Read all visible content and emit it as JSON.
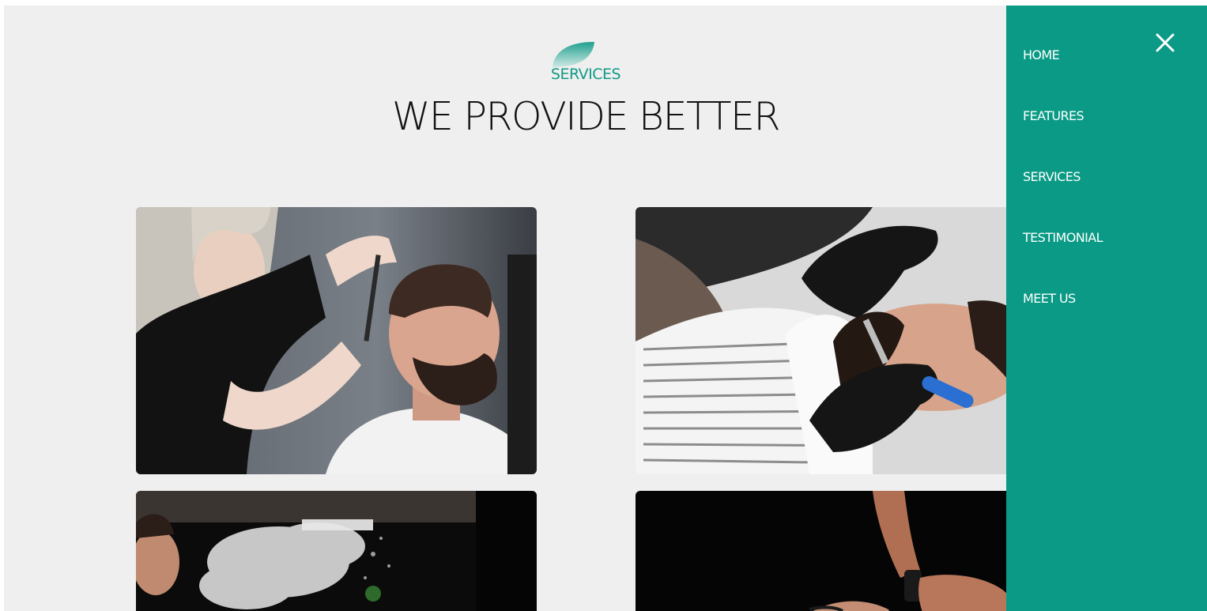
{
  "section": {
    "eyebrow": "SERVICES",
    "headline": "WE PROVIDE BETTER"
  },
  "gallery": [
    {
      "alt": "haircut-scissors-photo"
    },
    {
      "alt": "beard-shave-razor-photo"
    },
    {
      "alt": "hair-spray-photo"
    },
    {
      "alt": "beard-trim-photo"
    }
  ],
  "drawer": {
    "close_icon": "close-icon",
    "items": [
      {
        "label": "HOME"
      },
      {
        "label": "FEATURES"
      },
      {
        "label": "SERVICES"
      },
      {
        "label": "TESTIMONIAL"
      },
      {
        "label": "MEET US"
      }
    ]
  },
  "colors": {
    "accent": "#0a9a85",
    "page_bg": "#efefef",
    "headline": "#111111"
  }
}
